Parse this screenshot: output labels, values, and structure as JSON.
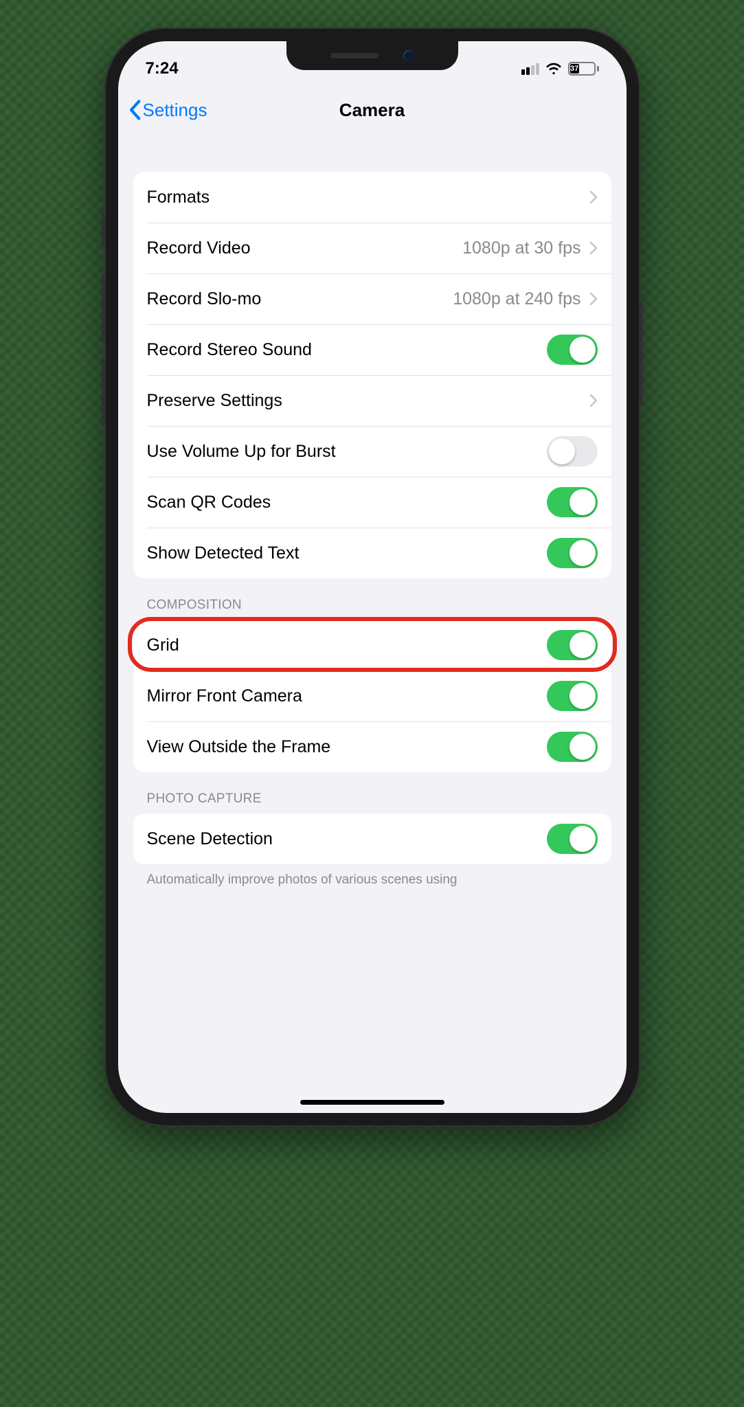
{
  "status": {
    "time": "7:24",
    "battery_pct": "37"
  },
  "nav": {
    "back_label": "Settings",
    "title": "Camera"
  },
  "section1": {
    "formats": "Formats",
    "record_video": "Record Video",
    "record_video_value": "1080p at 30 fps",
    "record_slomo": "Record Slo-mo",
    "record_slomo_value": "1080p at 240 fps",
    "record_stereo": "Record Stereo Sound",
    "preserve_settings": "Preserve Settings",
    "volume_burst": "Use Volume Up for Burst",
    "scan_qr": "Scan QR Codes",
    "detected_text": "Show Detected Text"
  },
  "section2": {
    "header": "Composition",
    "grid": "Grid",
    "mirror": "Mirror Front Camera",
    "view_outside": "View Outside the Frame"
  },
  "section3": {
    "header": "Photo Capture",
    "scene_detection": "Scene Detection",
    "footer": "Automatically improve photos of various scenes using"
  }
}
